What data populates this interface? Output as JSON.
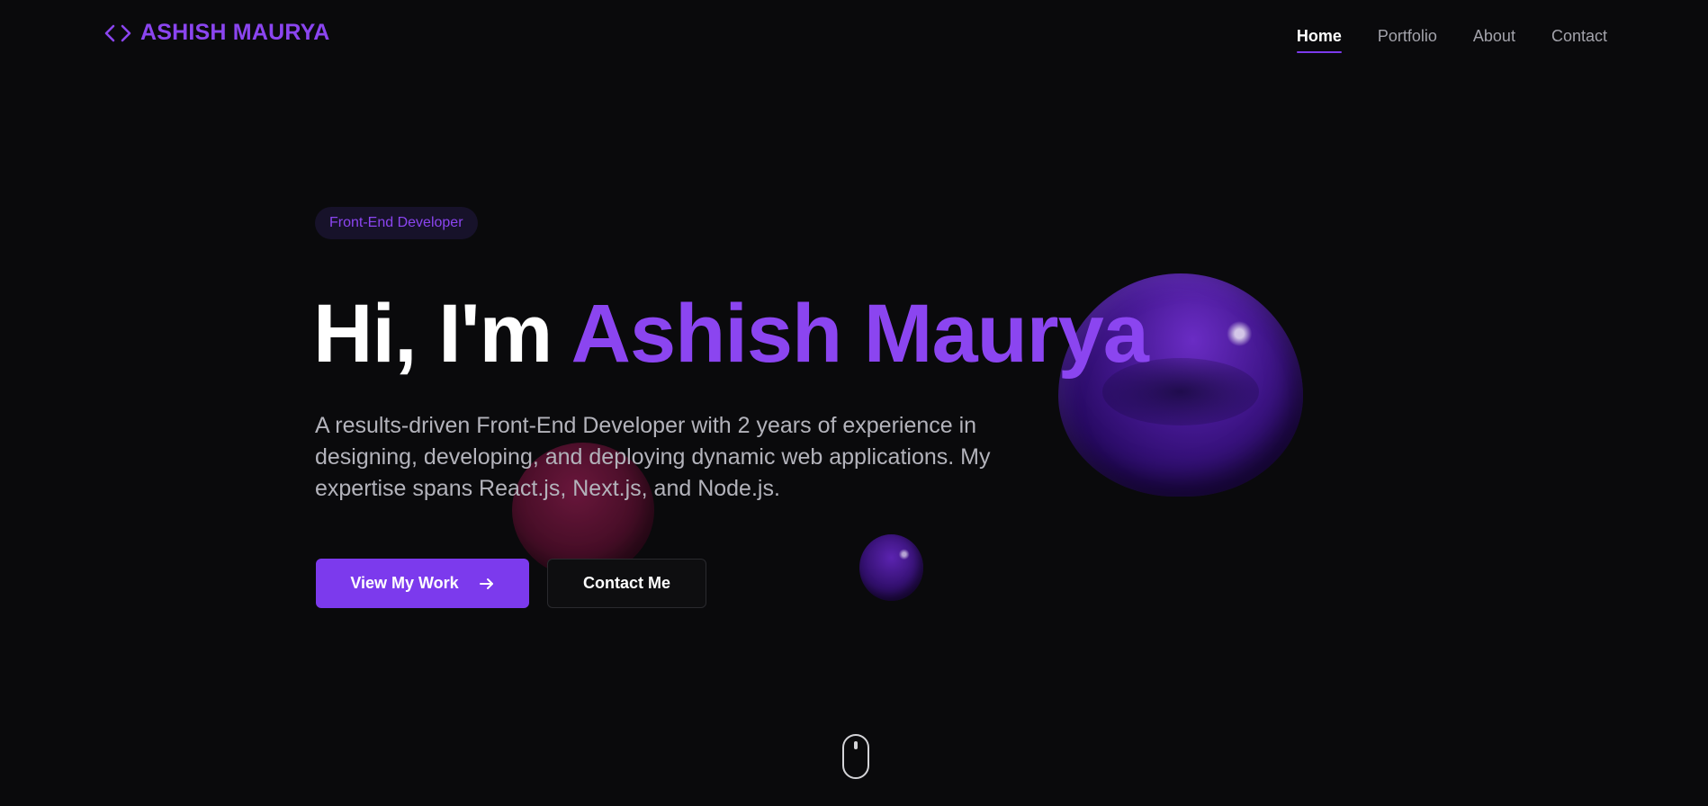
{
  "header": {
    "logo_text": "ASHISH MAURYA",
    "logo_icon": "code-brackets-icon",
    "nav": [
      {
        "label": "Home",
        "active": true
      },
      {
        "label": "Portfolio",
        "active": false
      },
      {
        "label": "About",
        "active": false
      },
      {
        "label": "Contact",
        "active": false
      }
    ]
  },
  "hero": {
    "badge": "Front-End Developer",
    "greeting": "Hi, I'm ",
    "name": "Ashish Maurya",
    "description": "A results-driven Front-End Developer with 2 years of experience in designing, developing, and deploying dynamic web applications. My expertise spans React.js, Next.js, and Node.js.",
    "primary_button": "View My Work",
    "primary_button_icon": "arrow-right-icon",
    "secondary_button": "Contact Me"
  },
  "scroll_indicator_icon": "mouse-scroll-icon",
  "colors": {
    "background": "#0a0a0c",
    "accent": "#7c3aed",
    "accent_text": "#8b45f0",
    "muted_text": "#a3a3ab"
  }
}
